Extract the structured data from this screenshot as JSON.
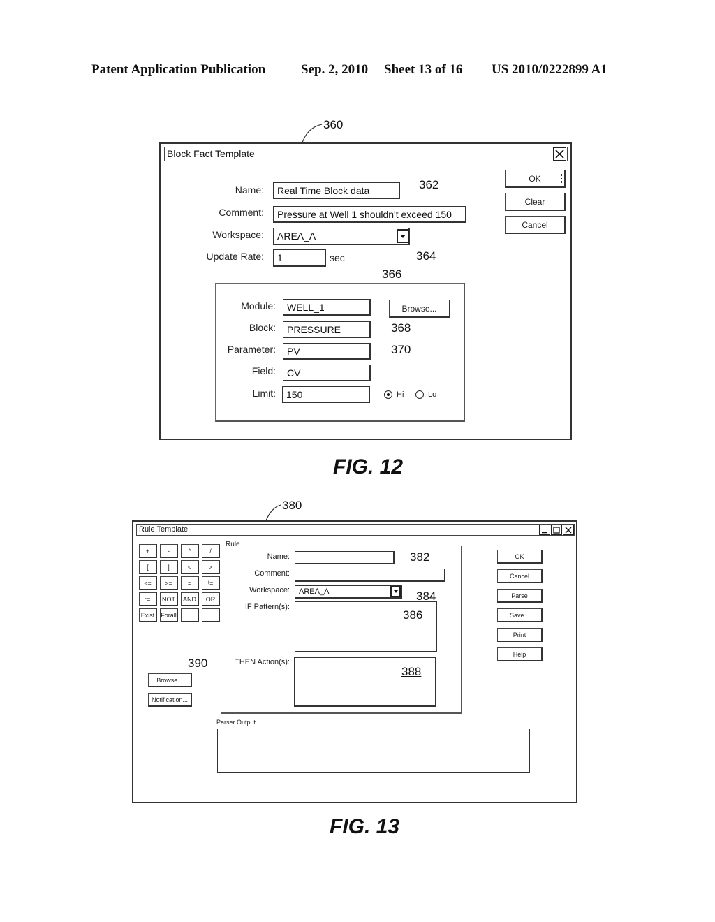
{
  "header": {
    "publication": "Patent Application Publication",
    "date": "Sep. 2, 2010",
    "sheet": "Sheet 13 of 16",
    "number": "US 2010/0222899 A1"
  },
  "fig12": {
    "caption": "FIG. 12",
    "window_title": "Block Fact Template",
    "refs": {
      "window": "360",
      "name": "362",
      "workspace": "364",
      "browse": "366",
      "block": "368",
      "parameter": "370"
    },
    "form": {
      "name_label": "Name:",
      "name_value": "Real Time Block data",
      "comment_label": "Comment:",
      "comment_value": "Pressure at Well 1 shouldn't exceed 150",
      "workspace_label": "Workspace:",
      "workspace_value": "AREA_A",
      "update_rate_label": "Update Rate:",
      "update_rate_value": "1",
      "update_rate_unit": "sec"
    },
    "block": {
      "module_label": "Module:",
      "module_value": "WELL_1",
      "browse_label": "Browse...",
      "block_label": "Block:",
      "block_value": "PRESSURE",
      "parameter_label": "Parameter:",
      "parameter_value": "PV",
      "field_label": "Field:",
      "field_value": "CV",
      "limit_label": "Limit:",
      "limit_value": "150",
      "radio_hi": "Hi",
      "radio_lo": "Lo",
      "selected": "Hi"
    },
    "buttons": {
      "ok": "OK",
      "clear": "Clear",
      "cancel": "Cancel"
    }
  },
  "fig13": {
    "caption": "FIG. 13",
    "window_title": "Rule Template",
    "refs": {
      "window": "380",
      "name": "382",
      "workspace": "384",
      "if_pattern": "386",
      "then_action": "388",
      "keypad": "390"
    },
    "keypad": [
      [
        "+",
        "-",
        "*",
        "/"
      ],
      [
        "[",
        "]",
        "<",
        ">"
      ],
      [
        "<=",
        ">=",
        "=",
        "!="
      ],
      [
        ":=",
        "NOT",
        "AND",
        "OR"
      ],
      [
        "Exist",
        "Forall",
        "",
        ""
      ]
    ],
    "left_buttons": {
      "browse": "Browse...",
      "notification": "Notification..."
    },
    "rule": {
      "legend": "Rule",
      "name_label": "Name:",
      "name_value": "",
      "comment_label": "Comment:",
      "comment_value": "",
      "workspace_label": "Workspace:",
      "workspace_value": "AREA_A",
      "if_label": "IF Pattern(s):",
      "if_value": "",
      "then_label": "THEN Action(s):",
      "then_value": ""
    },
    "parser_output_label": "Parser Output",
    "parser_output_value": "",
    "buttons": {
      "ok": "OK",
      "cancel": "Cancel",
      "parse": "Parse",
      "save": "Save...",
      "print": "Print",
      "help": "Help"
    }
  }
}
